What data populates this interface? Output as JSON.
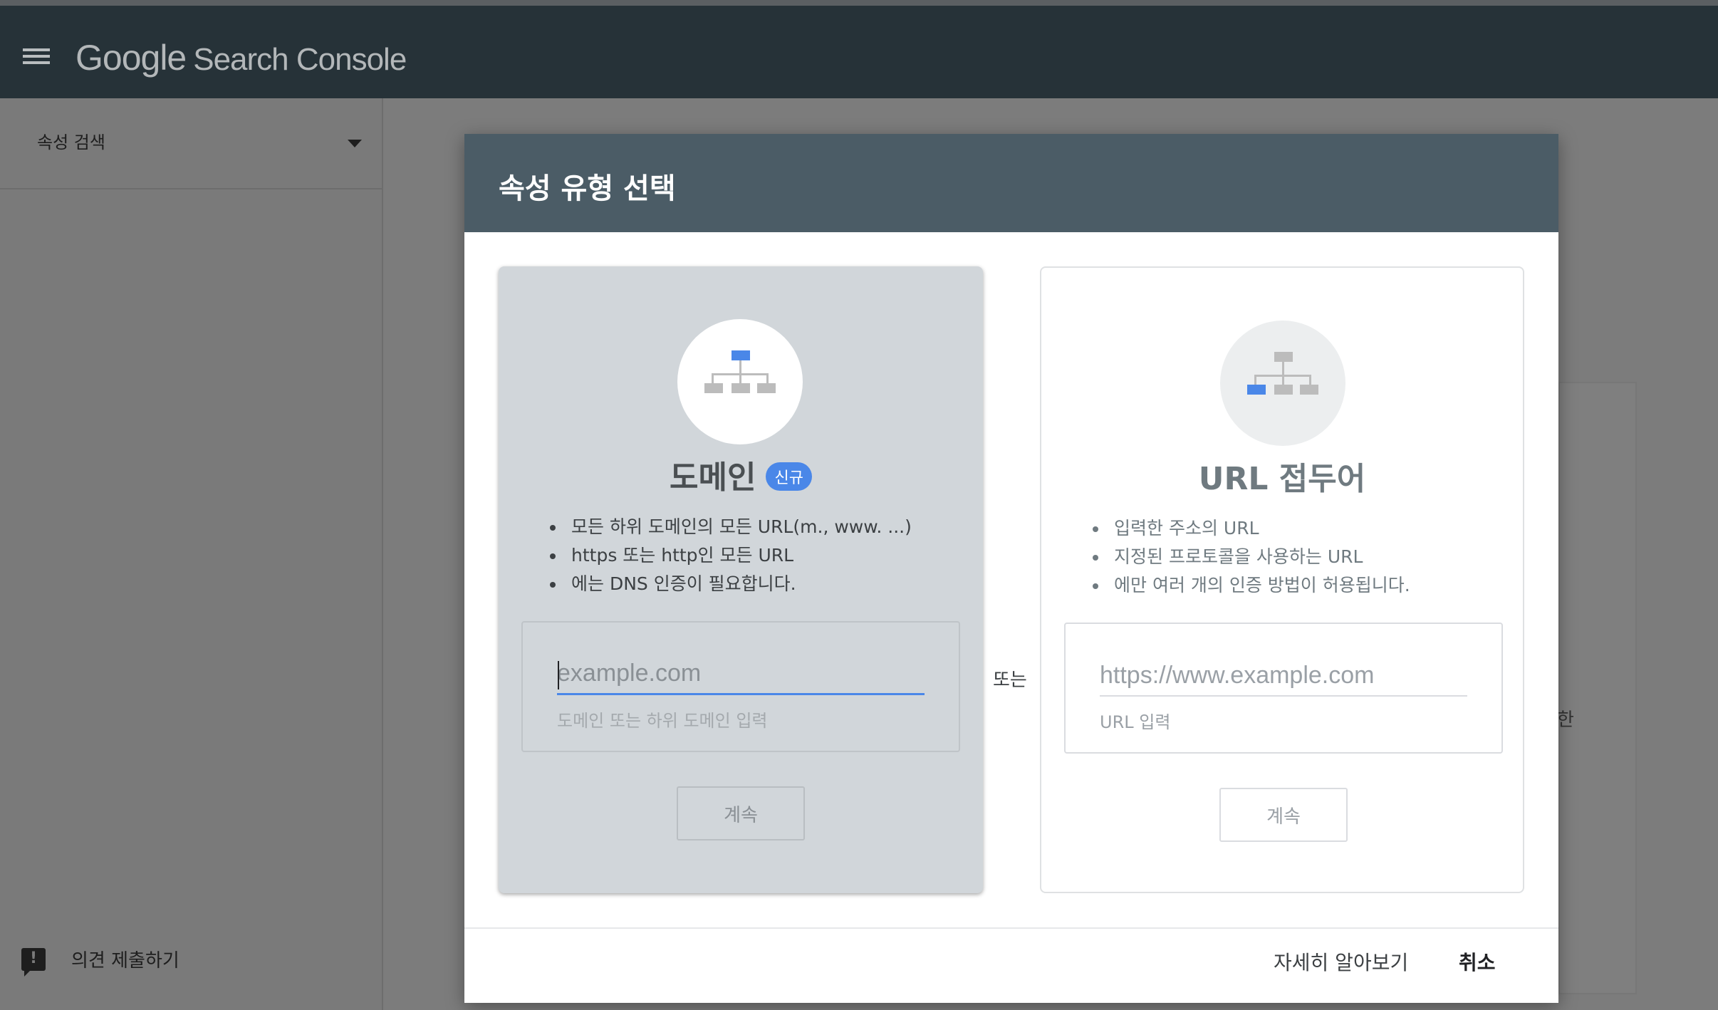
{
  "app": {
    "product_google": "Google",
    "product_name": "Search Console"
  },
  "sidebar": {
    "property_search_label": "속성 검색",
    "feedback_label": "의견 제출하기"
  },
  "background": {
    "fragment_text": "한"
  },
  "dialog": {
    "title": "속성 유형 선택",
    "or_label": "또는",
    "domain": {
      "title": "도메인",
      "badge": "신규",
      "icon": "sitemap-icon",
      "bullets": [
        "모든 하위 도메인의 모든 URL(m., www. ...)",
        "https 또는 http인 모든 URL",
        "에는 DNS 인증이 필요합니다."
      ],
      "input_placeholder": "example.com",
      "input_value": "",
      "input_hint": "도메인 또는 하위 도메인 입력",
      "continue_label": "계속"
    },
    "url_prefix": {
      "title": "URL 접두어",
      "icon": "sitemap-icon",
      "bullets": [
        "입력한 주소의 URL",
        "지정된 프로토콜을 사용하는 URL",
        "에만 여러 개의 인증 방법이 허용됩니다."
      ],
      "input_placeholder": "https://www.example.com",
      "input_value": "",
      "input_hint": "URL 입력",
      "continue_label": "계속"
    },
    "footer": {
      "learn_more_label": "자세히 알아보기",
      "cancel_label": "취소"
    }
  },
  "colors": {
    "appbar": "#263238",
    "dialog_header": "#4b5c66",
    "accent_blue": "#4a87e8",
    "selected_card": "#d1d6da"
  }
}
